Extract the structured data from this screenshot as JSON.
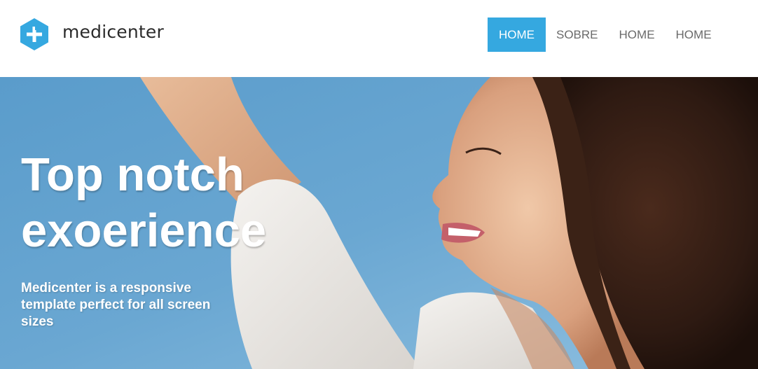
{
  "brand": {
    "name": "medicenter",
    "logo_icon": "medical-cross-hexagon-icon",
    "accent_color": "#35a8e0"
  },
  "nav": {
    "items": [
      {
        "label": "HOME",
        "active": true
      },
      {
        "label": "SOBRE",
        "active": false
      },
      {
        "label": "HOME",
        "active": false
      },
      {
        "label": "HOME",
        "active": false
      }
    ]
  },
  "hero": {
    "title": "Top notch exoerience",
    "subtitle": "Medicenter is a responsive template perfect for all screen sizes",
    "image": "woman-smiling-sky-photo"
  }
}
